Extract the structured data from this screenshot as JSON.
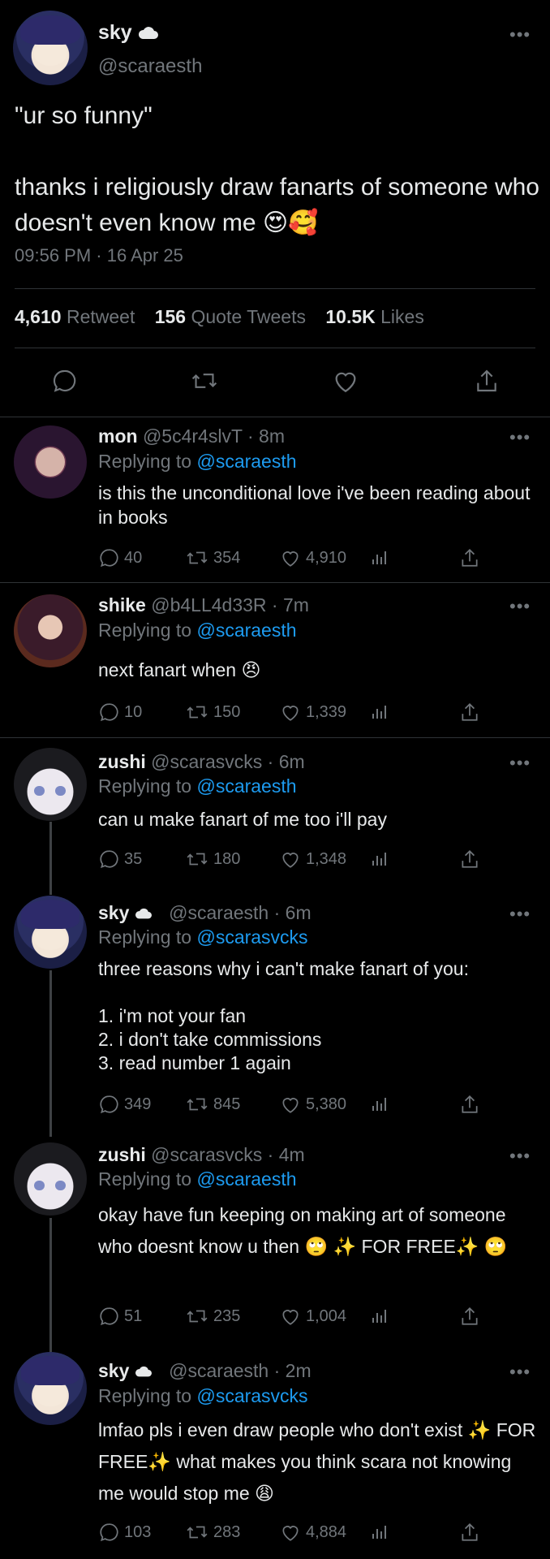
{
  "main_tweet": {
    "name": "sky",
    "name_emoji": "cloud-icon",
    "handle": "@scaraesth",
    "text": "\"ur so funny\"\n\nthanks i religiously draw fanarts of someone who doesn't even know me 😍🥰",
    "timestamp": "09:56 PM · 16 Apr 25",
    "stats": {
      "retweets": "4,610",
      "retweets_label": "Retweet",
      "quotes": "156",
      "quotes_label": "Quote Tweets",
      "likes": "10.5K",
      "likes_label": "Likes"
    }
  },
  "replies": [
    {
      "name": "mon",
      "handle": "@5c4r4slvT",
      "time": "· 8m",
      "replying_label": "Replying to",
      "replying_to": "@scaraesth",
      "text": "is this the unconditional love i've been reading about in books",
      "counts": {
        "reply": "40",
        "retweet": "354",
        "like": "4,910"
      }
    },
    {
      "name": "shike",
      "handle": "@b4LL4d33R",
      "time": "· 7m",
      "replying_label": "Replying to",
      "replying_to": "@scaraesth",
      "text": "next fanart when 😠",
      "counts": {
        "reply": "10",
        "retweet": "150",
        "like": "1,339"
      }
    },
    {
      "name": "zushi",
      "handle": "@scarasvcks",
      "time": "· 6m",
      "replying_label": "Replying to",
      "replying_to": "@scaraesth",
      "text": "can u make fanart of me too i'll pay",
      "counts": {
        "reply": "35",
        "retweet": "180",
        "like": "1,348"
      }
    },
    {
      "name": "sky",
      "handle": "@scaraesth",
      "time": "· 6m",
      "replying_label": "Replying to",
      "replying_to": "@scarasvcks",
      "text": "three reasons why i can't make fanart of you:\n\n1. i'm not your fan\n2. i don't take commissions\n3. read number 1 again",
      "counts": {
        "reply": "349",
        "retweet": "845",
        "like": "5,380"
      }
    },
    {
      "name": "zushi",
      "handle": "@scarasvcks",
      "time": "· 4m",
      "replying_label": "Replying to",
      "replying_to": "@scaraesth",
      "text": "okay have fun keeping on making art of someone who doesnt know u then 🙄 ✨ FOR FREE✨ 🙄",
      "counts": {
        "reply": "51",
        "retweet": "235",
        "like": "1,004"
      }
    },
    {
      "name": "sky",
      "handle": "@scaraesth",
      "time": "· 2m",
      "replying_label": "Replying to",
      "replying_to": "@scarasvcks",
      "text": "lmfao pls i even draw people who don't exist ✨ FOR FREE✨ what makes you think scara not knowing me would stop me 😩",
      "counts": {
        "reply": "103",
        "retweet": "283",
        "like": "4,884"
      }
    }
  ],
  "colors": {
    "background": "#000000",
    "text": "#e7e9ea",
    "muted": "#71767b",
    "link": "#1d9bf0",
    "divider": "#2f3336"
  }
}
